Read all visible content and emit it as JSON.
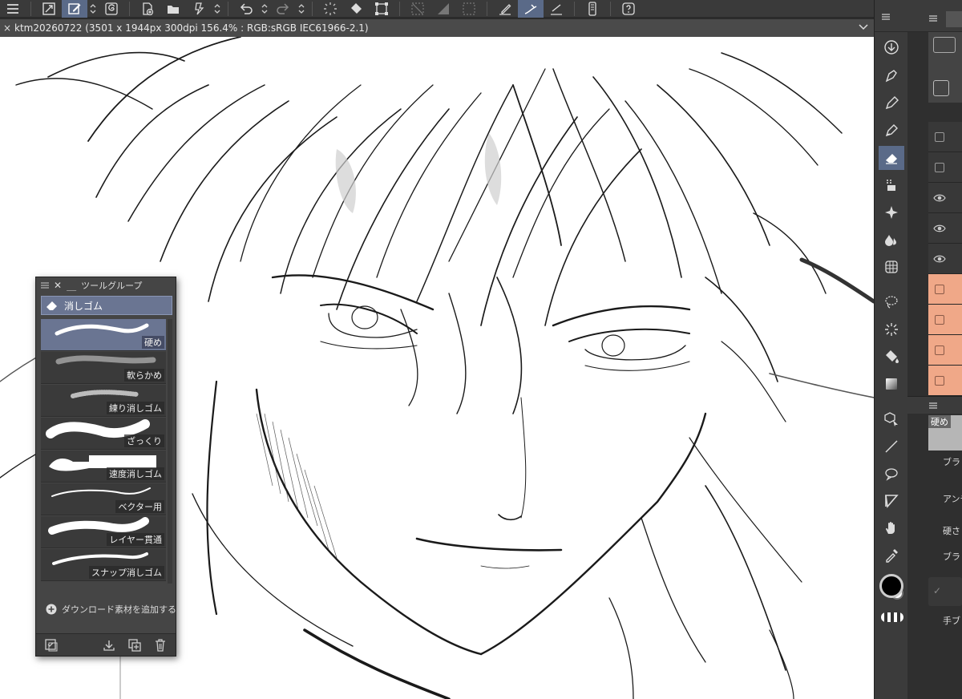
{
  "document": {
    "tab_title": "ktm20260722 (3501 x 1944px 300dpi 156.4% : RGB:sRGB IEC61966-2.1)",
    "close_glyph": "×"
  },
  "tool_group": {
    "title": "ツールグループ",
    "category": "消しゴム",
    "items": [
      {
        "name": "硬め"
      },
      {
        "name": "軟らかめ"
      },
      {
        "name": "練り消しゴム"
      },
      {
        "name": "ざっくり"
      },
      {
        "name": "速度消しゴム"
      },
      {
        "name": "ベクター用"
      },
      {
        "name": "レイヤー貫通"
      },
      {
        "name": "スナップ消しゴム"
      }
    ],
    "download_label": "ダウンロード素材を追加する"
  },
  "property_panel": {
    "preset_name": "硬め",
    "labels": [
      "ブラ",
      "アンチ",
      "硬さ",
      "ブラ",
      "手ブ"
    ]
  },
  "colors": {
    "accent": "#5a6a88",
    "layer_highlight": "#f0a888",
    "main_color": "#000000",
    "sub_color": "#ffffff"
  }
}
